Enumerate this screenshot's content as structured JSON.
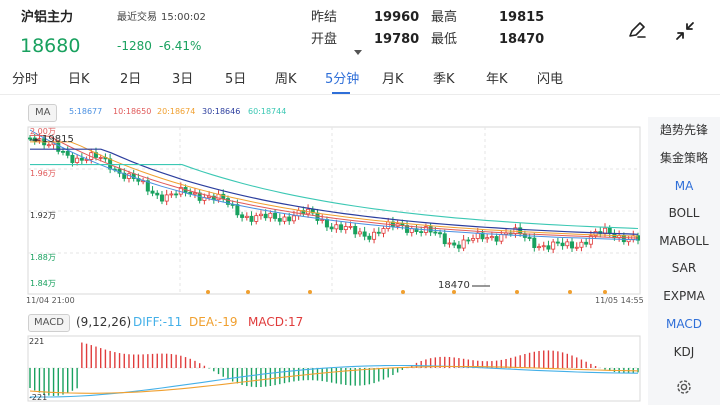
{
  "header": {
    "title": "沪铝主力",
    "last_trade_label": "最近交易",
    "last_trade_time": "15:00:02",
    "price": "18680",
    "change": "-1280",
    "change_pct": "-6.41%",
    "stats": [
      {
        "label": "昨结",
        "value": "19960"
      },
      {
        "label": "最高",
        "value": "19815"
      },
      {
        "label": "开盘",
        "value": "19780"
      },
      {
        "label": "最低",
        "value": "18470"
      }
    ],
    "icons": [
      "pen-icon",
      "collapse-icon",
      "caret-down-icon"
    ]
  },
  "tabs": {
    "items": [
      "分时",
      "日K",
      "2日",
      "3日",
      "5日",
      "周K",
      "5分钟",
      "月K",
      "季K",
      "年K",
      "闪电"
    ],
    "active": "5分钟"
  },
  "ma_legend": {
    "badge": "MA",
    "items": [
      {
        "label": "5:18677",
        "color": "#4a90e2"
      },
      {
        "label": "10:18650",
        "color": "#e05a5a"
      },
      {
        "label": "20:18674",
        "color": "#f0a030"
      },
      {
        "label": "30:18646",
        "color": "#2c3e9e"
      },
      {
        "label": "60:18744",
        "color": "#3cc8b4"
      }
    ]
  },
  "main_chart": {
    "y_ticks": [
      "2.00万",
      "1.96万",
      "1.92万",
      "1.88万",
      "1.84万"
    ],
    "high_label": "19815",
    "low_label": "18470",
    "start_time": "11/04 21:00",
    "end_time": "11/05 14:55"
  },
  "macd_legend": {
    "badge": "MACD",
    "params": "(9,12,26)",
    "diff": "DIFF:-11",
    "dea": "DEA:-19",
    "macd": "MACD:17"
  },
  "macd_chart": {
    "y_top": "221",
    "y_bottom": "-221"
  },
  "sidebar": {
    "items": [
      "趋势先锋",
      "集金策略",
      "MA",
      "BOLL",
      "MABOLL",
      "SAR",
      "EXPMA",
      "MACD",
      "KDJ"
    ],
    "active": [
      "MA",
      "MACD"
    ]
  },
  "colors": {
    "up": "#e03c3c",
    "down": "#19a15f",
    "accent": "#2f6fd8",
    "ma5": "#4a90e2",
    "ma10": "#e05a5a",
    "ma20": "#f0a030",
    "ma30": "#2c3e9e",
    "ma60": "#3cc8b4",
    "diff": "#44b0e8",
    "dea": "#f0a030"
  }
}
